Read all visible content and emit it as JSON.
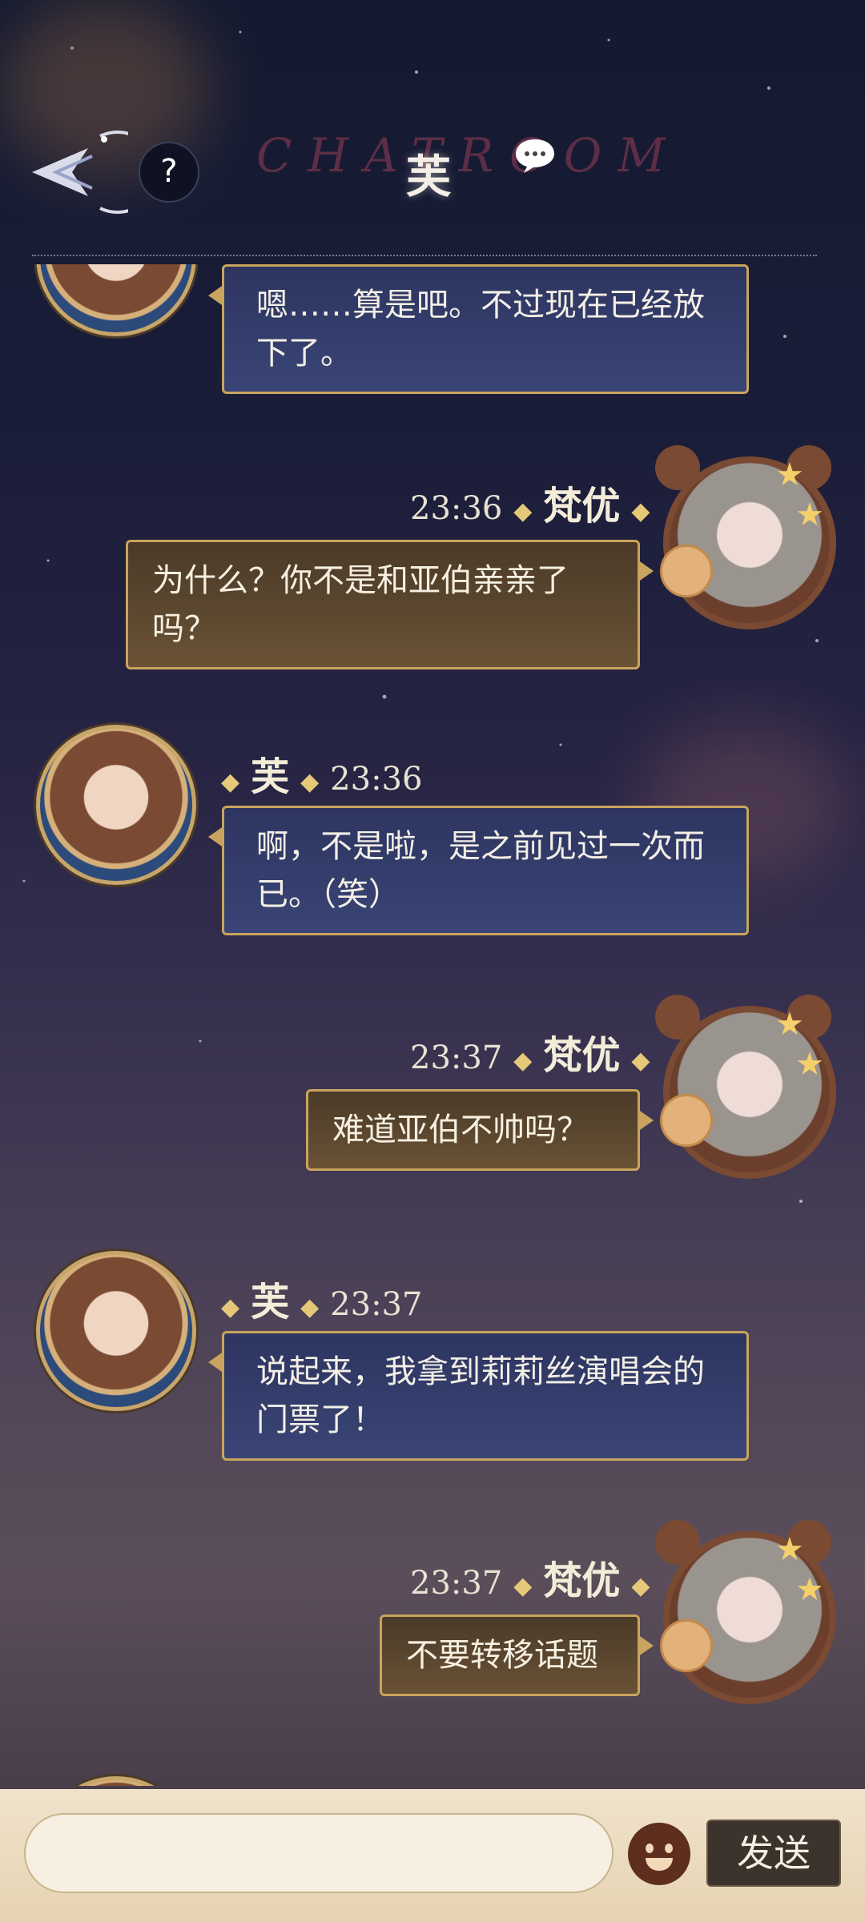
{
  "header": {
    "title": "芙",
    "bg_text": "CHATROOM",
    "help_label": "?"
  },
  "messages": [
    {
      "side": "left",
      "text": "嗯……算是吧。不过现在已经放下了。"
    },
    {
      "side": "right",
      "name": "梵优",
      "time": "23:36",
      "text": "为什么？你不是和亚伯亲亲了吗？"
    },
    {
      "side": "left",
      "name": "芙",
      "time": "23:36",
      "text": "啊，不是啦，是之前见过一次而已。（笑）"
    },
    {
      "side": "right",
      "name": "梵优",
      "time": "23:37",
      "text": "难道亚伯不帅吗？"
    },
    {
      "side": "left",
      "name": "芙",
      "time": "23:37",
      "text": "说起来，我拿到莉莉丝演唱会的门票了！"
    },
    {
      "side": "right",
      "name": "梵优",
      "time": "23:37",
      "text": "不要转移话题"
    }
  ],
  "input": {
    "placeholder": "",
    "send_label": "发送"
  },
  "colors": {
    "bubble_left": "#2d3560",
    "bubble_right": "#4a3a28",
    "gold_border": "#c9a45e"
  }
}
